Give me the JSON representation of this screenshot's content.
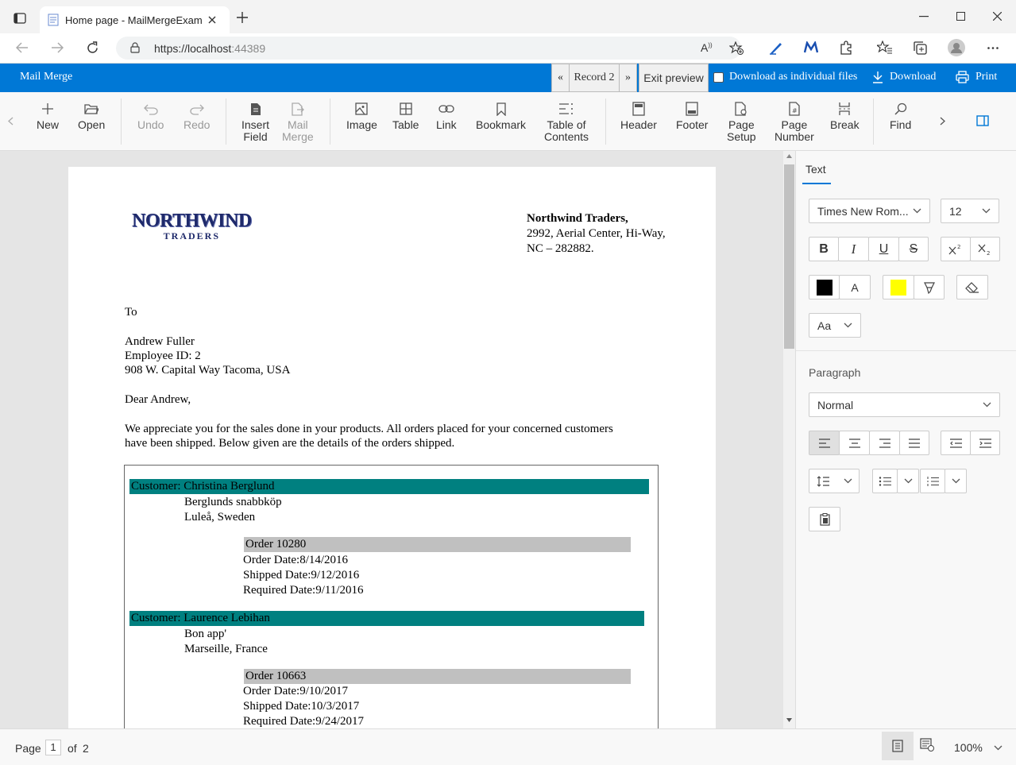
{
  "browser": {
    "tab_title": "Home page - MailMergeExample",
    "url_host": "https://localhost",
    "url_port": ":44389"
  },
  "app": {
    "title": "Mail Merge",
    "record_prev": "«",
    "record_label": "Record 2",
    "record_next": "»",
    "exit_preview": "Exit preview",
    "download_individual": "Download as individual files",
    "download": "Download",
    "print": "Print"
  },
  "toolbar": {
    "new": "New",
    "open": "Open",
    "undo": "Undo",
    "redo": "Redo",
    "insert_field_1": "Insert",
    "insert_field_2": "Field",
    "mail_merge_1": "Mail",
    "mail_merge_2": "Merge",
    "image": "Image",
    "table": "Table",
    "link": "Link",
    "bookmark": "Bookmark",
    "toc_1": "Table of",
    "toc_2": "Contents",
    "header": "Header",
    "footer": "Footer",
    "page_setup_1": "Page",
    "page_setup_2": "Setup",
    "page_number_1": "Page",
    "page_number_2": "Number",
    "break": "Break",
    "find": "Find"
  },
  "document": {
    "logo_line1": "NORTHWIND",
    "logo_line2": "TRADERS",
    "company_name": "Northwind Traders,",
    "company_addr1": "2992, Aerial Center, Hi-Way,",
    "company_addr2": "NC – 282882.",
    "to": "To",
    "recipient_name": "Andrew Fuller",
    "recipient_id": "Employee ID: 2",
    "recipient_addr": "908 W. Capital Way Tacoma, USA",
    "greeting": "Dear Andrew,",
    "body_line1": "We appreciate you for the sales done in your products. All orders placed for your concerned customers",
    "body_line2": "have been shipped. Below given are the details of the orders shipped.",
    "customers": [
      {
        "customer": "Customer: Christina Berglund",
        "company": "Berglunds snabbköp",
        "location": "Luleå, Sweden",
        "order": "Order 10280",
        "order_date": "Order Date:8/14/2016",
        "shipped_date": "Shipped Date:9/12/2016",
        "required_date": "Required Date:9/11/2016"
      },
      {
        "customer": "Customer: Laurence Lebihan",
        "company": "Bon app'",
        "location": "Marseille, France",
        "order": "Order 10663",
        "order_date": "Order Date:9/10/2017",
        "shipped_date": "Shipped Date:10/3/2017",
        "required_date": "Required Date:9/24/2017"
      }
    ]
  },
  "pane": {
    "tab_text": "Text",
    "font_family": "Times New Rom...",
    "font_size": "12",
    "bold": "B",
    "italic": "I",
    "underline": "U",
    "strike": "S",
    "change_case": "Aa",
    "font_color_label": "A",
    "paragraph_label": "Paragraph",
    "style": "Normal"
  },
  "status": {
    "page_label": "Page",
    "page_current": "1",
    "page_of": "of",
    "page_total": "2",
    "zoom": "100%"
  },
  "colors": {
    "accent": "#0078d6",
    "customer_bar": "#008080",
    "order_bar": "#c0c0c0",
    "highlight": "#ffff00",
    "font_color": "#000000",
    "logo": "#1f2a6b"
  }
}
